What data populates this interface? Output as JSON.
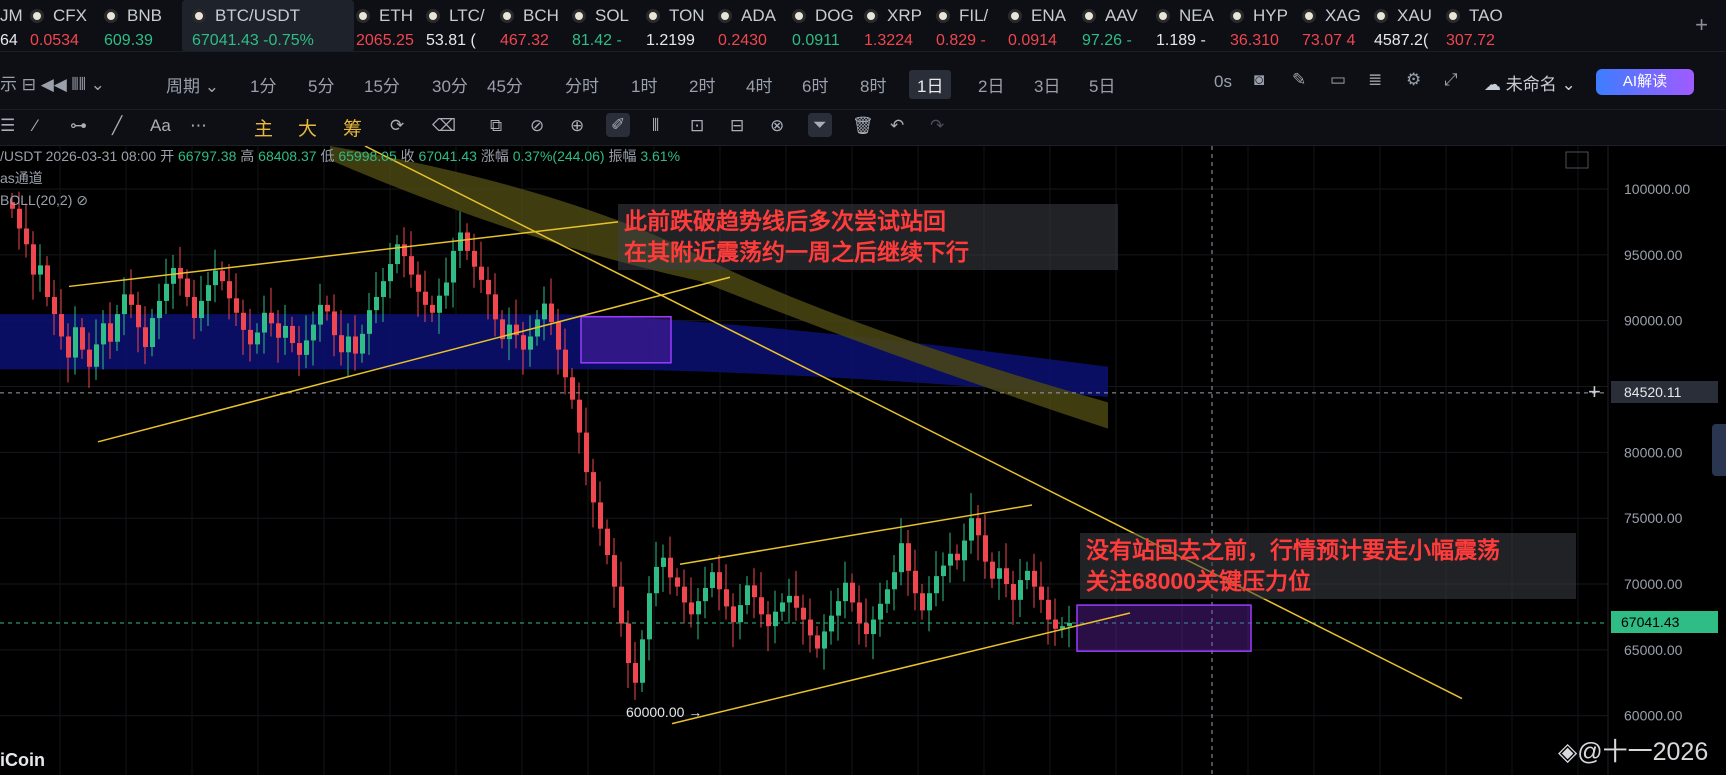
{
  "ticker": [
    {
      "sym": "JM",
      "price": "64",
      "trend": "wt"
    },
    {
      "sym": "CFX",
      "price": "0.0534",
      "trend": "dn"
    },
    {
      "sym": "BNB",
      "price": "609.39",
      "trend": "up"
    },
    {
      "sym": "BTC/USDT",
      "price": "67041.43  -0.75%",
      "trend": "up",
      "active": true
    },
    {
      "sym": "ETH",
      "price": "2065.25",
      "trend": "dn"
    },
    {
      "sym": "LTC/",
      "price": "53.81 (",
      "trend": "wt"
    },
    {
      "sym": "BCH",
      "price": "467.32",
      "trend": "dn"
    },
    {
      "sym": "SOL",
      "price": "81.42 -",
      "trend": "up"
    },
    {
      "sym": "TON",
      "price": "1.2199",
      "trend": "wt"
    },
    {
      "sym": "ADA",
      "price": "0.2430",
      "trend": "dn"
    },
    {
      "sym": "DOG",
      "price": "0.0911",
      "trend": "up"
    },
    {
      "sym": "XRP",
      "price": "1.3224",
      "trend": "dn"
    },
    {
      "sym": "FIL/",
      "price": "0.829 -",
      "trend": "dn"
    },
    {
      "sym": "ENA",
      "price": "0.0914",
      "trend": "dn"
    },
    {
      "sym": "AAV",
      "price": "97.26 -",
      "trend": "up"
    },
    {
      "sym": "NEA",
      "price": "1.189 -",
      "trend": "wt"
    },
    {
      "sym": "HYP",
      "price": "36.310",
      "trend": "dn"
    },
    {
      "sym": "XAG",
      "price": "73.07 4",
      "trend": "dn"
    },
    {
      "sym": "XAU",
      "price": "4587.2(",
      "trend": "wt"
    },
    {
      "sym": "TAO",
      "price": "307.72",
      "trend": "dn"
    }
  ],
  "ticker_plus": "+",
  "toolbar": {
    "icons_left": "示 ⊟ ◀◀ ⫴⫴ ⌄",
    "period_label": "周期 ⌄",
    "intervals": [
      "1分",
      "5分",
      "15分",
      "30分",
      "45分",
      "分时",
      "1时",
      "2时",
      "4时",
      "6时",
      "8时",
      "1日",
      "2日",
      "3日",
      "5日"
    ],
    "selected_interval": "1日",
    "zero_s": "0s",
    "account": "未命名 ⌄",
    "ai_label": "AI解读"
  },
  "drawbar": {
    "zhu": "主",
    "da": "大",
    "chou": "筹"
  },
  "info": {
    "prefix": "/USDT  2026-03-31 08:00  开",
    "open": "66797.38",
    "high_label": "高",
    "high": "68408.37",
    "low_label": "低",
    "low": "65998.05",
    "close_label": "收",
    "close": "67041.43",
    "chg_label": "涨幅",
    "chg": "0.37%(244.06)",
    "amp_label": "振幅",
    "amp": "3.61%",
    "ind1": "as通道",
    "ind2": "BOLL(20,2)"
  },
  "annotations": {
    "a1_line1": "此前跌破趋势线后多次尝试站回",
    "a1_line2": "在其附近震荡约一周之后继续下行",
    "a2_line1": "没有站回去之前，行情预计要走小幅震荡",
    "a2_line2": "关注68000关键压力位"
  },
  "crosshair_price": "84520.11",
  "current_price_tag": "67041.43",
  "low_marker": "60000.00 →",
  "watermark": "◈@十一2026",
  "brand": "iCoin",
  "colors": {
    "up": "#2fbd85",
    "down": "#f0464f",
    "line": "#e9c32a",
    "channel": "#1d2a9a",
    "box": "#8a2be2"
  },
  "chart_data": {
    "type": "candlestick",
    "title": "BTC/USDT",
    "interval": "1日",
    "y_ticks": [
      100000,
      95000,
      90000,
      85000,
      80000,
      75000,
      70000,
      65000,
      60000
    ],
    "y_tick_labels": [
      "100000.00",
      "95000.00",
      "90000.00",
      "84520.11",
      "80000.00",
      "75000.00",
      "70000.00",
      "65000.00",
      "60000.00"
    ],
    "ylim": [
      58000,
      103000
    ],
    "last_candle": {
      "date": "2026-03-31",
      "open": 66797.38,
      "high": 68408.37,
      "low": 65998.05,
      "close": 67041.43
    },
    "current_price": 67041.43,
    "crosshair": 84520.11,
    "key_low": 60000.0,
    "resistance": 68000,
    "closes": [
      98500,
      97000,
      95800,
      93500,
      94200,
      91800,
      90500,
      88800,
      87200,
      89500,
      87800,
      86500,
      88200,
      89800,
      88400,
      90500,
      92000,
      91200,
      89500,
      88000,
      90200,
      91500,
      92800,
      94000,
      93200,
      91800,
      90200,
      91500,
      92700,
      93800,
      93000,
      91700,
      90600,
      89300,
      88200,
      89100,
      90600,
      89800,
      88700,
      89600,
      88300,
      87400,
      88500,
      89700,
      91200,
      90700,
      88900,
      87600,
      88800,
      87500,
      89000,
      90800,
      91800,
      93000,
      94300,
      95800,
      94900,
      93500,
      92200,
      91200,
      90600,
      91900,
      92900,
      95300,
      96700,
      95300,
      94100,
      93100,
      92000,
      90100,
      88600,
      89700,
      88900,
      87800,
      88800,
      90100,
      91300,
      89900,
      87800,
      85700,
      84000,
      81500,
      78500,
      76200,
      74200,
      72200,
      69800,
      67000,
      64000,
      62500,
      65800,
      69300,
      71300,
      72000,
      70500,
      69800,
      68600,
      67700,
      68700,
      69700,
      70900,
      69600,
      68300,
      67100,
      68400,
      69900,
      69000,
      67700,
      66800,
      67900,
      68600,
      69100,
      68200,
      67300,
      66100,
      65100,
      66400,
      67600,
      68700,
      70100,
      68600,
      67000,
      66200,
      67300,
      68500,
      69600,
      70900,
      73100,
      71000,
      69300,
      68000,
      69300,
      70600,
      71400,
      72300,
      71800,
      73300,
      75000,
      73700,
      71700,
      70400,
      71200,
      70000,
      68800,
      70300,
      71000,
      69800,
      68800,
      67300,
      66600,
      66800,
      67041
    ]
  }
}
